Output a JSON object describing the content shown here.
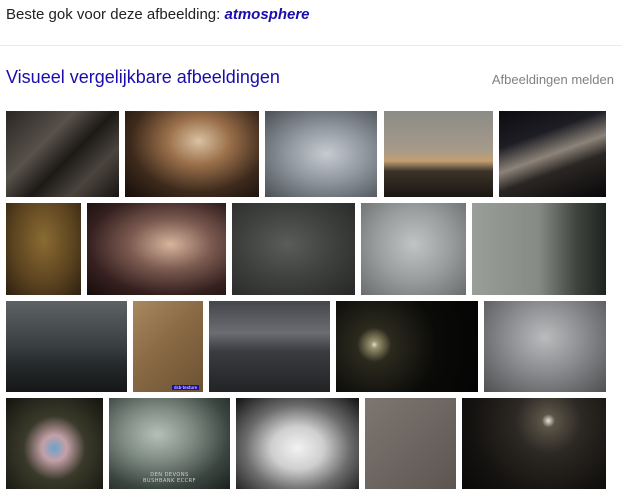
{
  "best_guess": {
    "prefix": "Beste gok voor deze afbeelding:",
    "query": "atmosphere"
  },
  "similar": {
    "title": "Visueel vergelijkbare afbeeldingen",
    "report_label": "Afbeeldingen melden"
  },
  "thumbnails": [
    {
      "name": "thumb-dark-texture",
      "subject": "dark smoky texture"
    },
    {
      "name": "thumb-amber-mist",
      "subject": "amber misty light"
    },
    {
      "name": "thumb-grey-sky",
      "subject": "grey overcast sky"
    },
    {
      "name": "thumb-road-horizon",
      "subject": "road to horizon at dusk"
    },
    {
      "name": "thumb-milky-way",
      "subject": "night sky with milky way"
    },
    {
      "name": "thumb-golden-grunge",
      "subject": "golden grunge texture"
    },
    {
      "name": "thumb-foggy-trees",
      "subject": "foggy trees at sunset"
    },
    {
      "name": "thumb-dark-grunge",
      "subject": "dark grey grunge texture"
    },
    {
      "name": "thumb-grey-gradient",
      "subject": "grey gradient background"
    },
    {
      "name": "thumb-foggy-field",
      "subject": "foggy field with trees"
    },
    {
      "name": "thumb-city-storm",
      "subject": "city under stormy sky"
    },
    {
      "name": "thumb-brown-paper",
      "subject": "brown paper texture",
      "tag": "dsb-texture"
    },
    {
      "name": "thumb-misty-mountains",
      "subject": "misty mountain valley"
    },
    {
      "name": "thumb-moon-clouds",
      "subject": "moon behind dark clouds"
    },
    {
      "name": "thumb-grey-clouds",
      "subject": "grey cumulus clouds"
    },
    {
      "name": "thumb-glowing-hands",
      "subject": "glowing hands"
    },
    {
      "name": "thumb-album-cover",
      "subject": "green foggy album cover",
      "caption_line1": "DEN DEVONS",
      "caption_line2": "BUSHBANK ECCRF"
    },
    {
      "name": "thumb-white-smoke",
      "subject": "white smoke on black"
    },
    {
      "name": "thumb-taupe-texture",
      "subject": "taupe plain texture"
    },
    {
      "name": "thumb-night-moon",
      "subject": "moon in night clouds"
    }
  ],
  "colors": {
    "link": "#1a0dab",
    "muted": "#808080",
    "divider": "#ebebeb"
  }
}
